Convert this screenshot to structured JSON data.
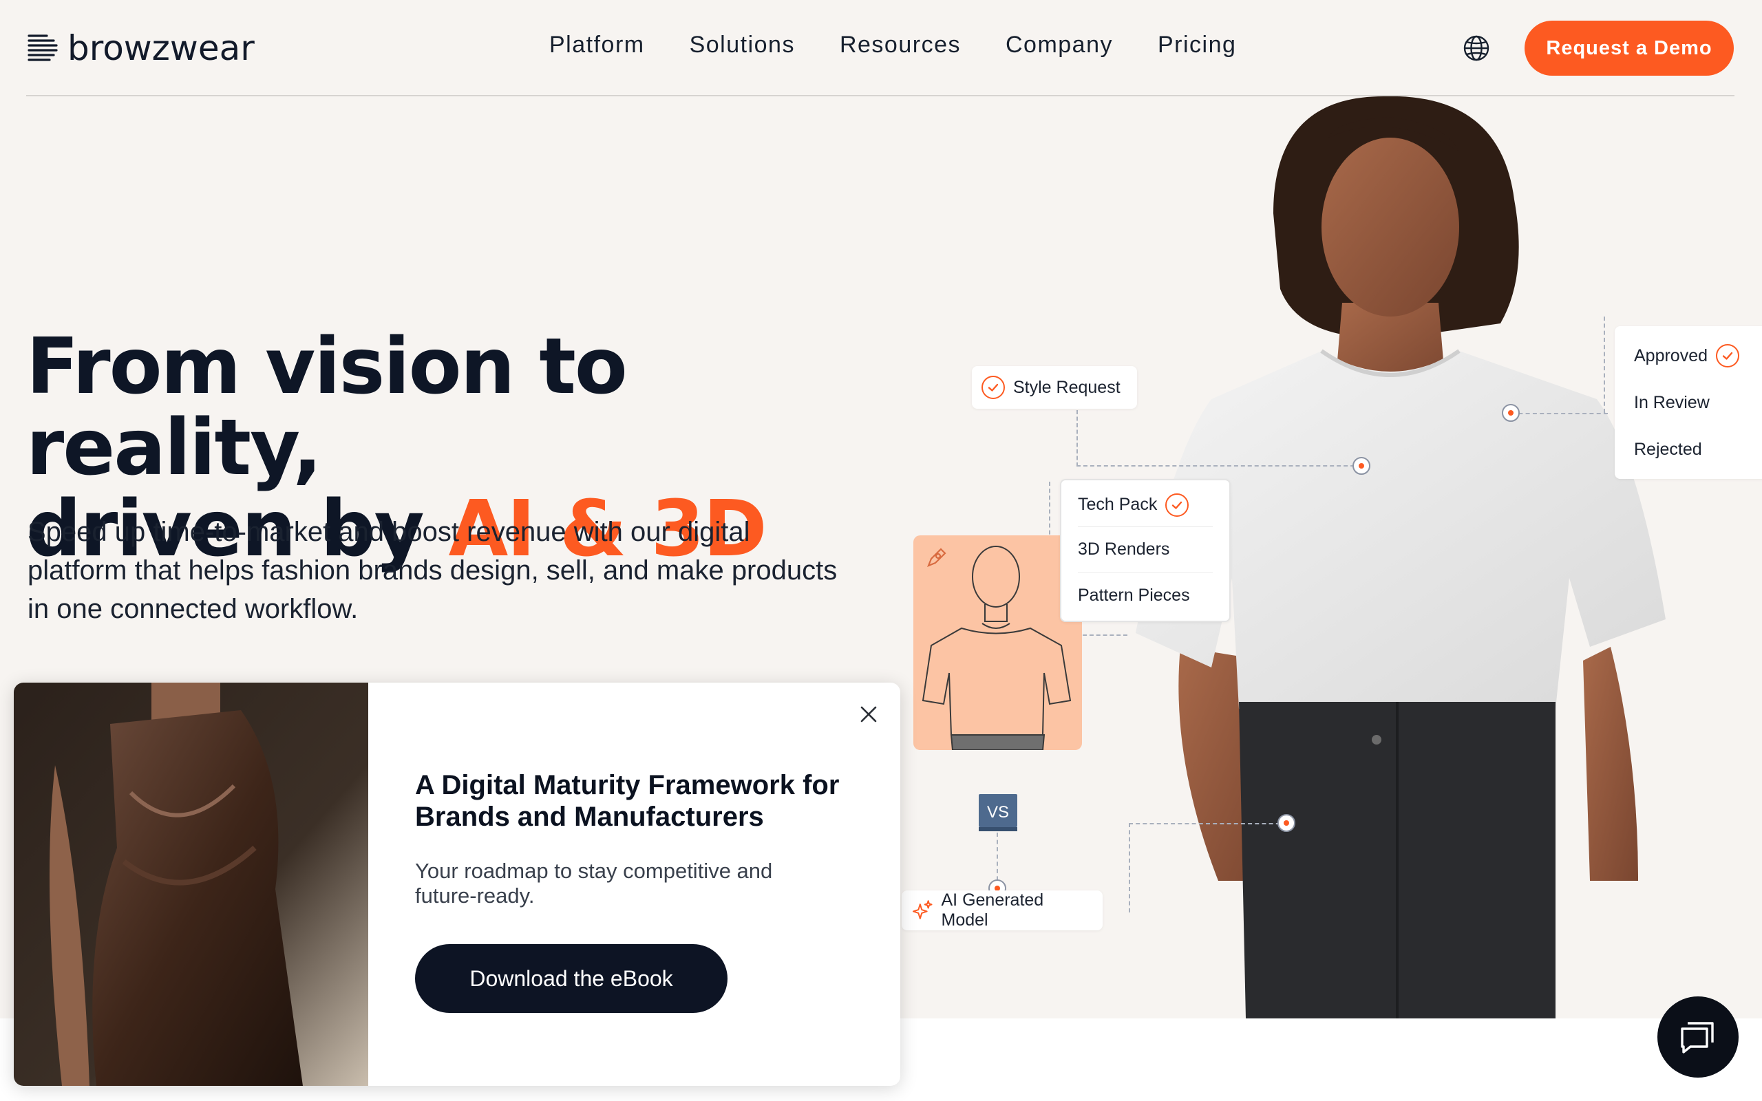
{
  "header": {
    "logo_text": "browzwear",
    "nav": [
      "Platform",
      "Solutions",
      "Resources",
      "Company",
      "Pricing"
    ],
    "demo_button": "Request a Demo"
  },
  "hero": {
    "headline_line1": "From vision to reality,",
    "headline_line2_prefix": "driven by ",
    "headline_accent": "AI & 3D",
    "subtext": "Speed up time-to-market and boost revenue with our digital platform that helps fashion brands design, sell, and make products in one connected workflow."
  },
  "workflow": {
    "style_request": "Style Request",
    "tech_pack": "Tech Pack",
    "renders": "3D Renders",
    "pattern_pieces": "Pattern Pieces",
    "status": [
      "Approved",
      "In Review",
      "Rejected"
    ],
    "vs_label": "VS",
    "ai_model": "AI Generated Model"
  },
  "popup": {
    "title": "A Digital Maturity Framework for Brands and Manufacturers",
    "description": "Your roadmap to stay competitive and future-ready.",
    "button": "Download the eBook"
  },
  "colors": {
    "accent": "#fd5a21",
    "dark": "#0d1424",
    "hero_bg": "#f7f4f1"
  },
  "icons": [
    "logo-mark-icon",
    "globe-icon",
    "check-icon",
    "close-icon",
    "sparkle-icon",
    "pen-icon",
    "chat-icon"
  ]
}
